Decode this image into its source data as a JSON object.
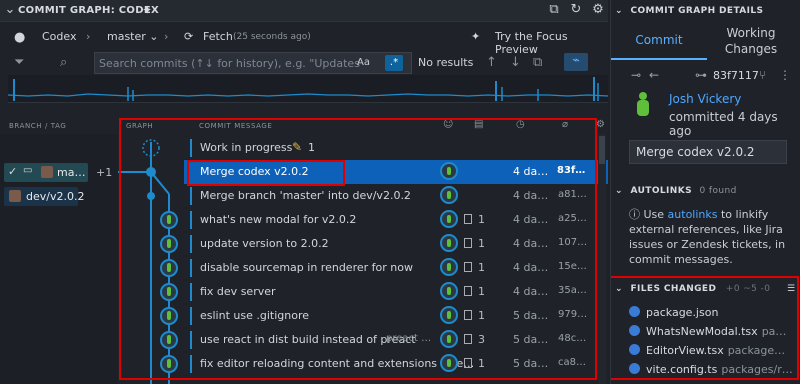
{
  "header": {
    "title": "COMMIT GRAPH: CODEX",
    "sparkle": "✦"
  },
  "toolbar": {
    "repo": "Codex",
    "branch": "master",
    "fetch": "Fetch",
    "fetch_time": "(25 seconds ago)",
    "focus": "Try the Focus Preview"
  },
  "search": {
    "placeholder": "Search commits (↑↓ for history), e.g. \"Updates dependen",
    "aa": "Aa",
    "regex": ".*",
    "result": "No results"
  },
  "columns": {
    "branch": "BRANCH / TAG",
    "graph": "GRAPH",
    "message": "COMMIT MESSAGE"
  },
  "branches": [
    {
      "label": "ma…",
      "plus": "+1"
    },
    {
      "label": "dev/v2.0.2"
    }
  ],
  "commits": [
    {
      "message": "Work in progress",
      "count": "1",
      "date": "",
      "sha": "",
      "extra": ""
    },
    {
      "message": "Merge codex v2.0.2",
      "count": "",
      "date": "4 da…",
      "sha": "83f…",
      "extra": ""
    },
    {
      "message": "Merge branch 'master' into dev/v2.0.2",
      "count": "",
      "date": "4 da…",
      "sha": "a81…",
      "extra": ""
    },
    {
      "message": "what's new modal for v2.0.2",
      "count": "1",
      "date": "4 da…",
      "sha": "a25…",
      "extra": ""
    },
    {
      "message": "update version to 2.0.2",
      "count": "1",
      "date": "4 da…",
      "sha": "107…",
      "extra": ""
    },
    {
      "message": "disable sourcemap in renderer for now",
      "count": "1",
      "date": "4 da…",
      "sha": "15e…",
      "extra": ""
    },
    {
      "message": "fix dev server",
      "count": "1",
      "date": "4 da…",
      "sha": "35a…",
      "extra": ""
    },
    {
      "message": "eslint use .gitignore",
      "count": "1",
      "date": "5 da…",
      "sha": "979…",
      "extra": ""
    },
    {
      "message": "use react in dist build instead of preact",
      "count": "3",
      "date": "5 da…",
      "sha": "48c…",
      "extra": "preact …"
    },
    {
      "message": "fix editor reloading content and extensions whe…",
      "count": "1",
      "date": "5 da…",
      "sha": "ca8…",
      "extra": ""
    }
  ],
  "details": {
    "section_title": "COMMIT GRAPH DETAILS",
    "tab_commit": "Commit",
    "tab_working": "Working Changes",
    "sha": "83f7117",
    "author": "Josh Vickery",
    "committed": "committed 4 days ago",
    "commit_message": "Merge codex v2.0.2"
  },
  "autolinks": {
    "title": "AUTOLINKS",
    "count": "0 found",
    "text_pre": "Use ",
    "link": "autolinks",
    "text_post": " to linkify external references, like Jira issues or Zendesk tickets, in commit messages."
  },
  "files_changed": {
    "title": "FILES CHANGED",
    "stats": "+0  ~5  -0",
    "files": [
      {
        "name": "package.json",
        "path": ""
      },
      {
        "name": "WhatsNewModal.tsx",
        "path": "pa…"
      },
      {
        "name": "EditorView.tsx",
        "path": "package…"
      },
      {
        "name": "vite.config.ts",
        "path": "packages/r…"
      }
    ]
  },
  "colors": {
    "accent": "#1d8bcd",
    "selected": "#0e61b8",
    "highlight": "#e00000",
    "link": "#4fa6ff"
  }
}
